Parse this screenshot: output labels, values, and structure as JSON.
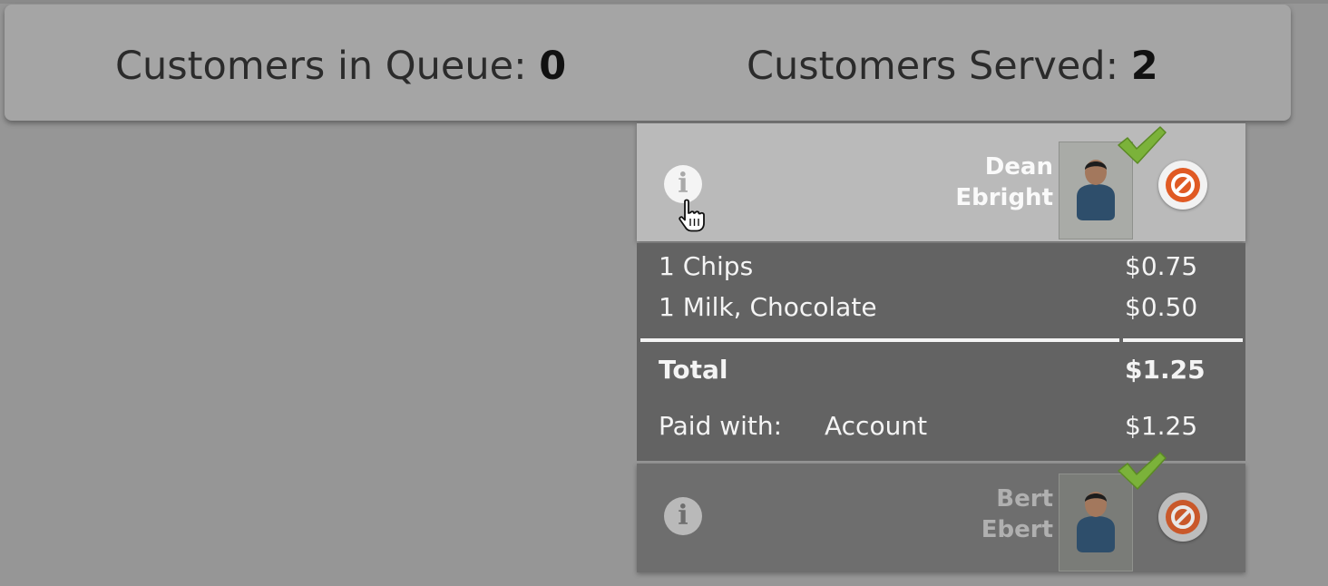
{
  "stats": {
    "queue_label": "Customers in Queue: ",
    "queue_count": "0",
    "served_label": "Customers Served: ",
    "served_count": "2"
  },
  "customers": [
    {
      "first_name": "Dean",
      "last_name": "Ebright",
      "status": "served",
      "order": {
        "items": [
          {
            "label": "1 Chips",
            "price": "$0.75"
          },
          {
            "label": "1 Milk, Chocolate",
            "price": "$0.50"
          }
        ],
        "total_label": "Total",
        "total": "$1.25",
        "paid_label": "Paid with:",
        "paid_method": "Account",
        "paid_amount": "$1.25"
      }
    },
    {
      "first_name": "Bert",
      "last_name": "Ebert",
      "status": "served"
    }
  ],
  "icons": {
    "info": "info-icon",
    "avatar": "person-avatar-icon",
    "check": "checkmark-icon",
    "cancel": "no-entry-icon",
    "cursor": "hand-pointer-cursor"
  },
  "colors": {
    "check": "#7bb23a",
    "cancel": "#e05a24"
  }
}
